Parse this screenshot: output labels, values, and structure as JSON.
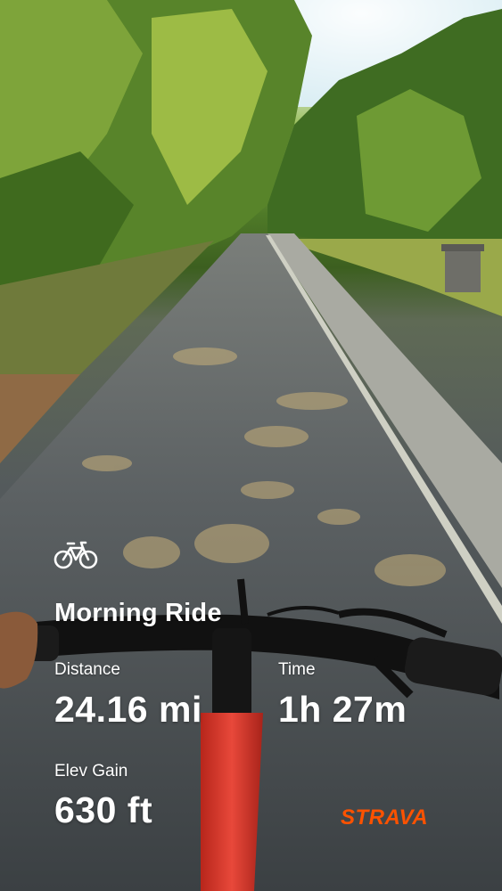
{
  "activity": {
    "title": "Morning Ride",
    "icon": "bike-icon"
  },
  "stats": {
    "distance": {
      "label": "Distance",
      "value": "24.16 mi"
    },
    "time": {
      "label": "Time",
      "value": "1h 27m"
    },
    "elev_gain": {
      "label": "Elev Gain",
      "value": "630 ft"
    }
  },
  "brand": {
    "name": "STRAVA",
    "color": "#fc5200"
  },
  "colors": {
    "text": "#ffffff"
  }
}
